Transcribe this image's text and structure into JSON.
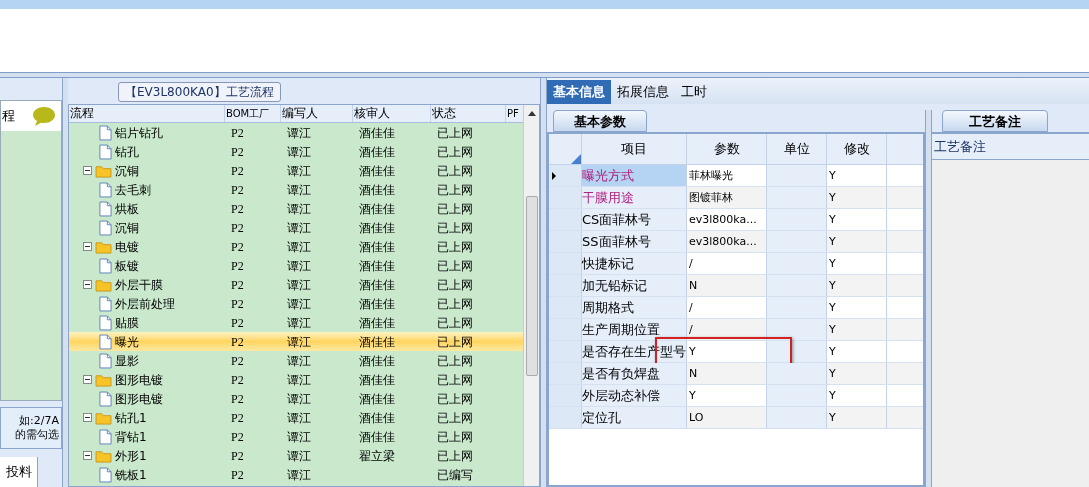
{
  "left_panel": {
    "heading": "程",
    "note_lines": [
      "如:2/7A",
      "的需勾选"
    ],
    "tabs": [
      {
        "label": "投料",
        "selected": true
      }
    ]
  },
  "flow_panel": {
    "title": "【EV3L800KA0】工艺流程",
    "columns": [
      "流程",
      "BOM工厂",
      "编写人",
      "核审人",
      "状态",
      "PF"
    ],
    "nodes": [
      {
        "kind": "continuation",
        "children": [
          {
            "kind": "file",
            "label": "铝片钻孔",
            "factory": "P2",
            "writer": "谭江",
            "reviewer": "酒佳佳",
            "status": "已上网",
            "selected": false
          },
          {
            "kind": "file",
            "label": "钻孔",
            "factory": "P2",
            "writer": "谭江",
            "reviewer": "酒佳佳",
            "status": "已上网",
            "selected": false
          }
        ]
      },
      {
        "kind": "folder",
        "label": "沉铜",
        "factory": "P2",
        "writer": "谭江",
        "reviewer": "酒佳佳",
        "status": "已上网",
        "selected": false,
        "expanded": true,
        "children": [
          {
            "kind": "file",
            "label": "去毛刺",
            "factory": "P2",
            "writer": "谭江",
            "reviewer": "酒佳佳",
            "status": "已上网",
            "selected": false
          },
          {
            "kind": "file",
            "label": "烘板",
            "factory": "P2",
            "writer": "谭江",
            "reviewer": "酒佳佳",
            "status": "已上网",
            "selected": false
          },
          {
            "kind": "file",
            "label": "沉铜",
            "factory": "P2",
            "writer": "谭江",
            "reviewer": "酒佳佳",
            "status": "已上网",
            "selected": false
          }
        ]
      },
      {
        "kind": "folder",
        "label": "电镀",
        "factory": "P2",
        "writer": "谭江",
        "reviewer": "酒佳佳",
        "status": "已上网",
        "selected": false,
        "expanded": true,
        "children": [
          {
            "kind": "file",
            "label": "板镀",
            "factory": "P2",
            "writer": "谭江",
            "reviewer": "酒佳佳",
            "status": "已上网",
            "selected": false
          }
        ]
      },
      {
        "kind": "folder",
        "label": "外层干膜",
        "factory": "P2",
        "writer": "谭江",
        "reviewer": "酒佳佳",
        "status": "已上网",
        "selected": false,
        "expanded": true,
        "children": [
          {
            "kind": "file",
            "label": "外层前处理",
            "factory": "P2",
            "writer": "谭江",
            "reviewer": "酒佳佳",
            "status": "已上网",
            "selected": false
          },
          {
            "kind": "file",
            "label": "贴膜",
            "factory": "P2",
            "writer": "谭江",
            "reviewer": "酒佳佳",
            "status": "已上网",
            "selected": false
          },
          {
            "kind": "file",
            "label": "曝光",
            "factory": "P2",
            "writer": "谭江",
            "reviewer": "酒佳佳",
            "status": "已上网",
            "selected": true
          },
          {
            "kind": "file",
            "label": "显影",
            "factory": "P2",
            "writer": "谭江",
            "reviewer": "酒佳佳",
            "status": "已上网",
            "selected": false
          }
        ]
      },
      {
        "kind": "folder",
        "label": "图形电镀",
        "factory": "P2",
        "writer": "谭江",
        "reviewer": "酒佳佳",
        "status": "已上网",
        "selected": false,
        "expanded": true,
        "children": [
          {
            "kind": "file",
            "label": "图形电镀",
            "factory": "P2",
            "writer": "谭江",
            "reviewer": "酒佳佳",
            "status": "已上网",
            "selected": false
          }
        ]
      },
      {
        "kind": "folder",
        "label": "钻孔1",
        "factory": "P2",
        "writer": "谭江",
        "reviewer": "酒佳佳",
        "status": "已上网",
        "selected": false,
        "expanded": true,
        "children": [
          {
            "kind": "file",
            "label": "背钻1",
            "factory": "P2",
            "writer": "谭江",
            "reviewer": "酒佳佳",
            "status": "已上网",
            "selected": false
          }
        ]
      },
      {
        "kind": "folder",
        "label": "外形1",
        "factory": "P2",
        "writer": "谭江",
        "reviewer": "翟立梁",
        "status": "已上网",
        "selected": false,
        "expanded": true,
        "children": [
          {
            "kind": "file",
            "label": "铣板1",
            "factory": "P2",
            "writer": "谭江",
            "status": "已编写",
            "selected": false
          }
        ]
      }
    ]
  },
  "detail_tabs": [
    {
      "label": "基本信息",
      "selected": true
    },
    {
      "label": "拓展信息",
      "selected": false
    },
    {
      "label": "工时",
      "selected": false
    }
  ],
  "params_panel": {
    "tab": "基本参数",
    "columns": [
      "项目",
      "参数",
      "单位",
      "修改"
    ],
    "rows": [
      {
        "item": "曝光方式",
        "value": "菲林曝光",
        "modified": "Y",
        "highlighted": true,
        "selected": true,
        "annotated": false
      },
      {
        "item": "干膜用途",
        "value": "图镀菲林",
        "modified": "Y",
        "highlighted": true,
        "selected": false,
        "annotated": false
      },
      {
        "item": "CS面菲林号",
        "value": "ev3l800ka...",
        "modified": "Y",
        "highlighted": false,
        "selected": false,
        "annotated": false
      },
      {
        "item": "SS面菲林号",
        "value": "ev3l800ka...",
        "modified": "Y",
        "highlighted": false,
        "selected": false,
        "annotated": false
      },
      {
        "item": "快捷标记",
        "value": "/",
        "modified": "Y",
        "highlighted": false,
        "selected": false,
        "annotated": false
      },
      {
        "item": "加无铅标记",
        "value": "N",
        "modified": "Y",
        "highlighted": false,
        "selected": false,
        "annotated": false
      },
      {
        "item": "周期格式",
        "value": "/",
        "modified": "Y",
        "highlighted": false,
        "selected": false,
        "annotated": false
      },
      {
        "item": "生产周期位置",
        "value": "/",
        "modified": "Y",
        "highlighted": false,
        "selected": false,
        "annotated": false
      },
      {
        "item": "是否存在生产型号",
        "value": "Y",
        "modified": "Y",
        "highlighted": false,
        "selected": false,
        "annotated": true
      },
      {
        "item": "是否有负焊盘",
        "value": "N",
        "modified": "Y",
        "highlighted": false,
        "selected": false,
        "annotated": false
      },
      {
        "item": "外层动态补偿",
        "value": "Y",
        "modified": "Y",
        "highlighted": false,
        "selected": false,
        "annotated": false
      },
      {
        "item": "定位孔",
        "value": "LO",
        "modified": "Y",
        "highlighted": false,
        "selected": false,
        "annotated": false
      }
    ]
  },
  "notes_panel": {
    "tab": "工艺备注",
    "label": "工艺备注"
  }
}
